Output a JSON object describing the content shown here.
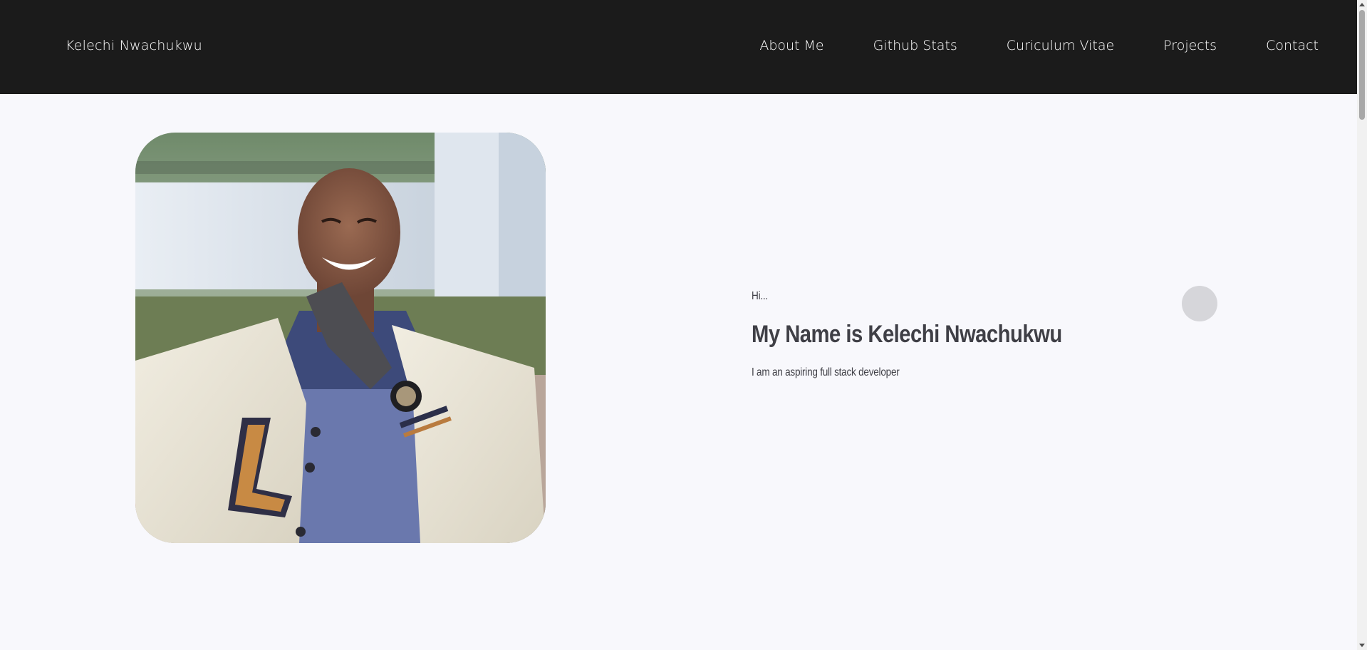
{
  "header": {
    "brand": "Kelechi Nwachukwu",
    "nav": [
      {
        "label": "About Me"
      },
      {
        "label": "Github Stats"
      },
      {
        "label": "Curiculum Vitae"
      },
      {
        "label": "Projects"
      },
      {
        "label": "Contact"
      }
    ]
  },
  "hero": {
    "photo_icon": "profile-photo",
    "greeting": "Hi...",
    "headline": "My Name is Kelechi Nwachukwu",
    "tagline": "I am an aspiring full stack developer"
  },
  "colors": {
    "header_bg": "#1b1b1b",
    "page_bg": "#f8f8fc",
    "text": "#3f3f46",
    "accent_circle": "#d6d6da"
  }
}
